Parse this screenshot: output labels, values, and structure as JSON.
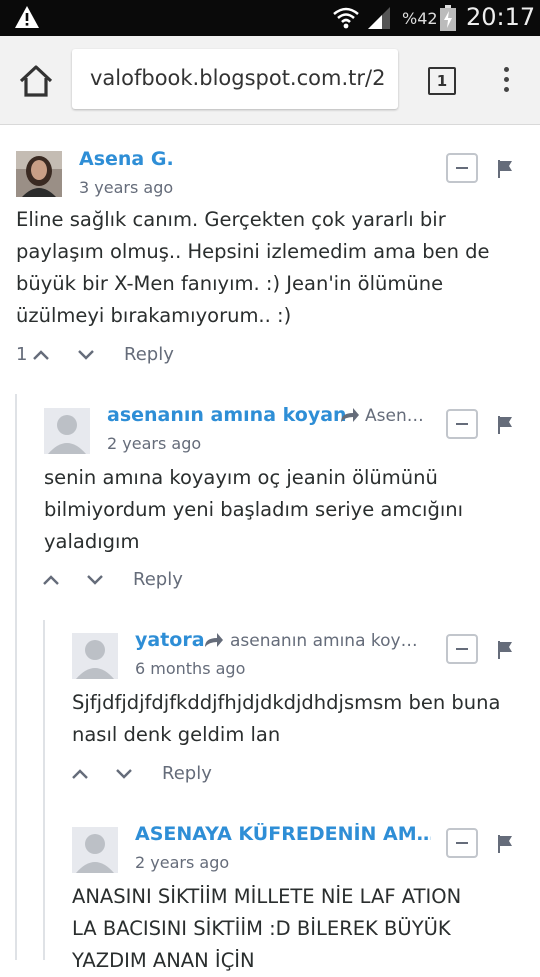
{
  "status_bar": {
    "battery_percent": "%42",
    "time": "20:17"
  },
  "browser": {
    "url": "valofbook.blogspot.com.tr/2",
    "tab_count": "1"
  },
  "comments": [
    {
      "author": "Asena G.",
      "time_ago": "3 years ago",
      "lines": [
        "Eline sağlık canım. Gerçekten çok yararlı bir",
        "paylaşım olmuş.. Hepsini izlemedim ama ben de",
        "büyük bir X-Men fanıyım. :) Jean'in ölümüne",
        "üzülmeyi bırakamıyorum.. :)"
      ],
      "votes": "1",
      "reply_label": "Reply"
    },
    {
      "author": "asenanın amına koyan",
      "reply_to": "Asen…",
      "time_ago": "2 years ago",
      "lines": [
        "senin amına koyayım oç jeanin ölümünü",
        "bilmiyordum yeni başladım seriye amcığını",
        "yaladıgım"
      ],
      "reply_label": "Reply"
    },
    {
      "author": "yatora",
      "reply_to": "asenanın amına koy…",
      "time_ago": "6 months ago",
      "lines": [
        "Sjfjdfjdjfdjfkddjfhjdjdkdjdhdjsmsm ben buna",
        "nasıl denk geldim lan"
      ],
      "reply_label": "Reply"
    },
    {
      "author": "ASENAYA KÜFREDENİN AM…",
      "time_ago": "2 years ago",
      "lines": [
        "ANASINI SİKTİİM MİLLETE NİE LAF ATION",
        "LA BACISINI SİKTİİM :D BİLEREK BÜYÜK",
        "YAZDIM ANAN İÇİN"
      ]
    }
  ],
  "colors": {
    "author": "#2e8ed6",
    "meta": "#656c7a"
  }
}
